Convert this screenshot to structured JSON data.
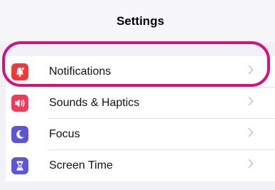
{
  "header": {
    "title": "Settings"
  },
  "rows": [
    {
      "label": "Notifications",
      "icon": "bell-icon",
      "color": "#f0383a"
    },
    {
      "label": "Sounds & Haptics",
      "icon": "speaker-icon",
      "color": "#f03a5a"
    },
    {
      "label": "Focus",
      "icon": "moon-icon",
      "color": "#5b55d6"
    },
    {
      "label": "Screen Time",
      "icon": "hourglass-icon",
      "color": "#5c56d8"
    }
  ],
  "highlight": {
    "color": "#d6127a"
  }
}
